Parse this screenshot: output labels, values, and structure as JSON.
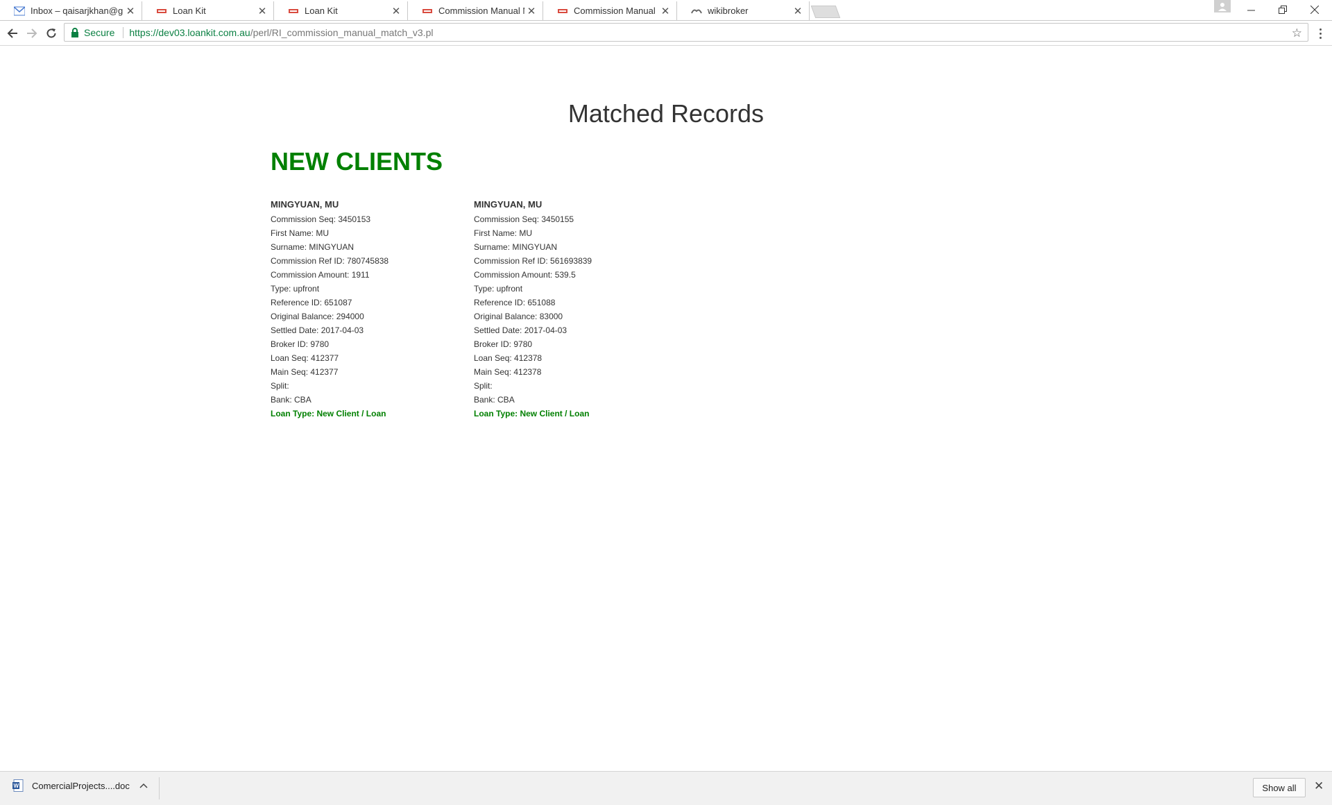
{
  "browser": {
    "tabs": [
      {
        "title": "Inbox – qaisarjkhan@gm",
        "icon": "gmail-icon",
        "active": false
      },
      {
        "title": "Loan Kit",
        "icon": "loankit-favicon",
        "active": false
      },
      {
        "title": "Loan Kit",
        "icon": "loankit-favicon",
        "active": false
      },
      {
        "title": "Commission Manual Mat",
        "icon": "loankit-favicon",
        "active": true
      },
      {
        "title": "Commission Manual Mat",
        "icon": "loankit-favicon",
        "active": false
      },
      {
        "title": "wikibroker",
        "icon": "wikibroker-favicon",
        "active": false
      }
    ],
    "omnibox": {
      "secure_label": "Secure",
      "url_main": "https://dev03.loankit.com.au",
      "url_rest": "/perl/RI_commission_manual_match_v3.pl"
    }
  },
  "page": {
    "title": "Matched Records",
    "section_title": "NEW CLIENTS",
    "records": [
      {
        "name": "MINGYUAN, MU",
        "lines": [
          "Commission Seq: 3450153",
          "First Name: MU",
          "Surname: MINGYUAN",
          "Commission Ref ID: 780745838",
          "Commission Amount: 1911",
          "Type: upfront",
          "Reference ID: 651087",
          "Original Balance: 294000",
          "Settled Date: 2017-04-03",
          "Broker ID: 9780",
          "Loan Seq: 412377",
          "Main Seq: 412377",
          "Split:",
          "Bank: CBA"
        ],
        "loan_type": "Loan Type: New Client / Loan"
      },
      {
        "name": "MINGYUAN, MU",
        "lines": [
          "Commission Seq: 3450155",
          "First Name: MU",
          "Surname: MINGYUAN",
          "Commission Ref ID: 561693839",
          "Commission Amount: 539.5",
          "Type: upfront",
          "Reference ID: 651088",
          "Original Balance: 83000",
          "Settled Date: 2017-04-03",
          "Broker ID: 9780",
          "Loan Seq: 412378",
          "Main Seq: 412378",
          "Split:",
          "Bank: CBA"
        ],
        "loan_type": "Loan Type: New Client / Loan"
      }
    ]
  },
  "download_bar": {
    "file_name": "ComercialProjects....doc",
    "file_icon": "word-doc-icon",
    "show_all_label": "Show all"
  },
  "colors": {
    "accent_green": "#008000",
    "secure_green": "#0b8043"
  }
}
